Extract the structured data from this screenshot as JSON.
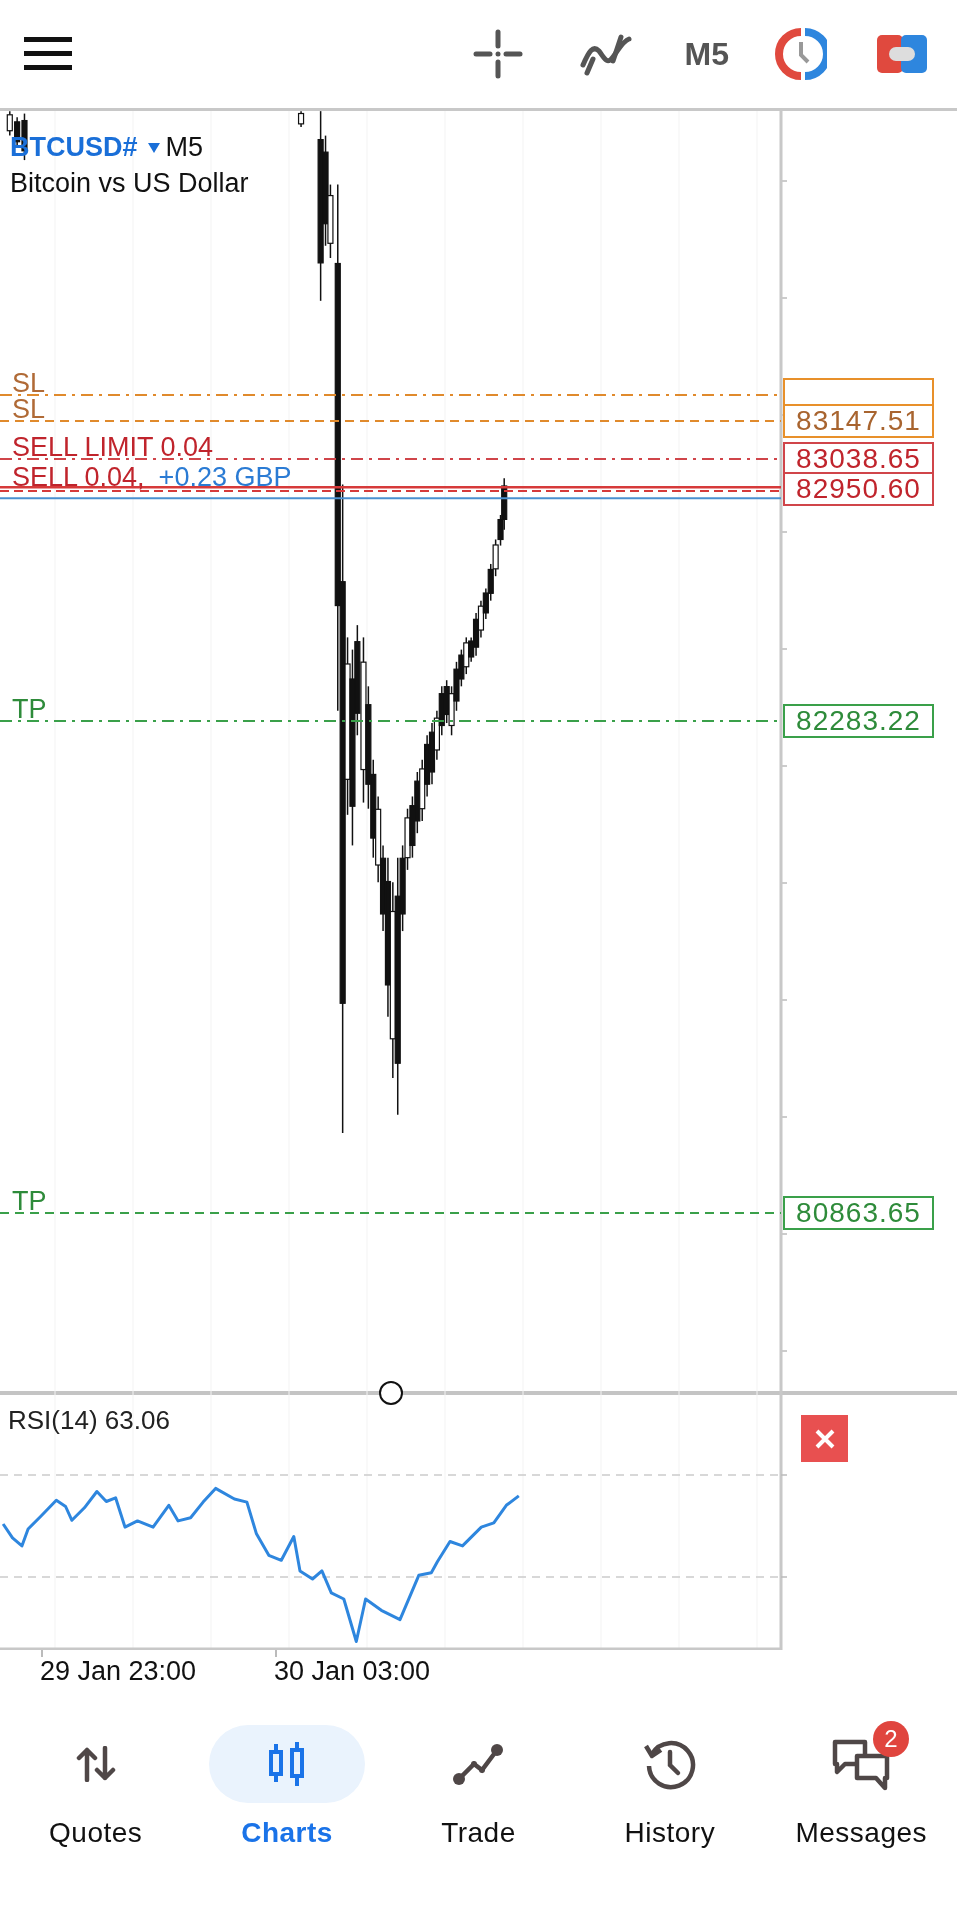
{
  "toolbar": {
    "timeframe": "M5"
  },
  "chart": {
    "symbol": "BTCUSD#",
    "timeframe": "M5",
    "description": "Bitcoin vs US Dollar",
    "levels": [
      {
        "kind": "sl",
        "dash_dot": true,
        "label": "SL"
      },
      {
        "kind": "sl",
        "dash_dot": false,
        "label": "SL",
        "price": "83147.51"
      },
      {
        "kind": "order",
        "dash_dot": true,
        "label": "SELL LIMIT 0.04",
        "price": "83038.65"
      },
      {
        "kind": "position",
        "label": "SELL 0.04,",
        "profit": "+0.23 GBP",
        "price": "82950.60"
      },
      {
        "kind": "tp",
        "dash_dot": true,
        "label": "TP",
        "price": "82283.22"
      },
      {
        "kind": "tp",
        "dash_dot": false,
        "label": "TP",
        "price": "80863.65"
      }
    ]
  },
  "rsi": {
    "label": "RSI(14) 63.06"
  },
  "time_axis": [
    "29 Jan 23:00",
    "30 Jan 03:00"
  ],
  "nav": {
    "items": [
      {
        "label": "Quotes",
        "selected": false
      },
      {
        "label": "Charts",
        "selected": true
      },
      {
        "label": "Trade",
        "selected": false
      },
      {
        "label": "History",
        "selected": false
      },
      {
        "label": "Messages",
        "selected": false,
        "badge": "2"
      }
    ]
  }
}
